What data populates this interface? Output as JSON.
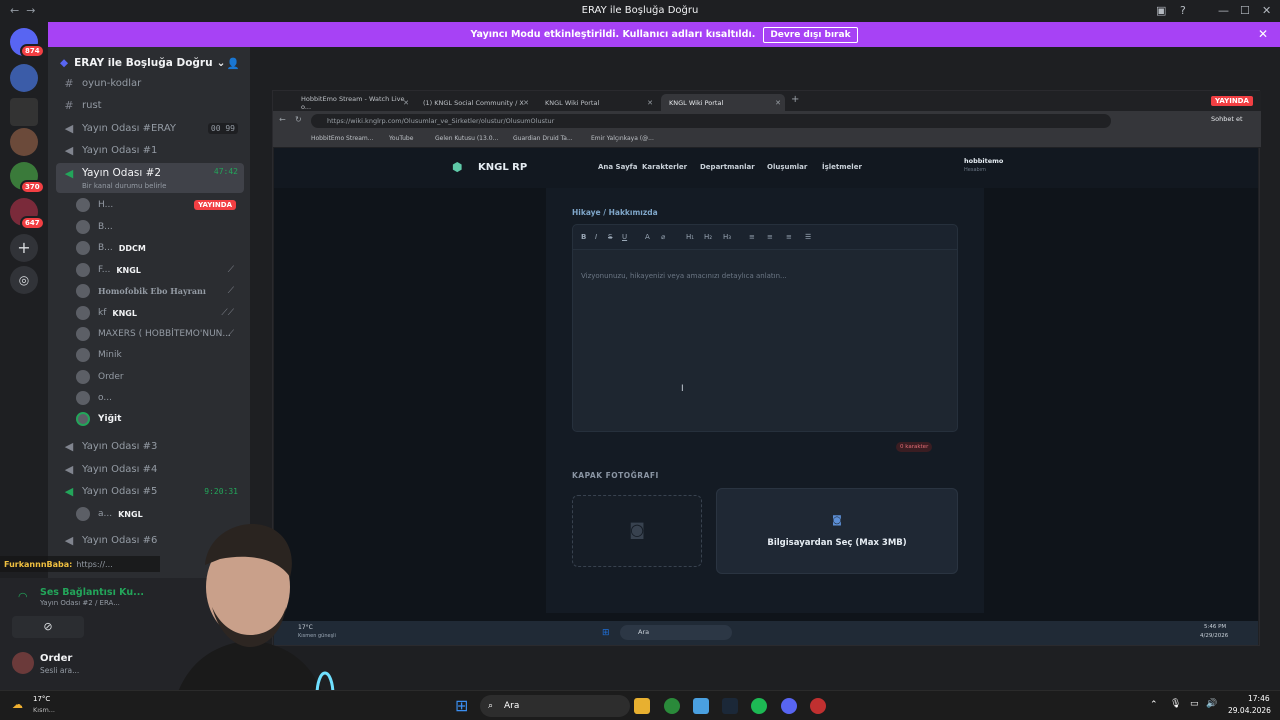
{
  "window": {
    "title": "ERAY ile Boşluğa Doğru"
  },
  "banner": {
    "text": "Yayıncı Modu etkinleştirildi. Kullanıcı adları kısaltıldı.",
    "button": "Devre dışı bırak"
  },
  "rail": {
    "badges": [
      "874",
      "370",
      "647"
    ]
  },
  "server": {
    "name": "ERAY ile Boşluğa Doğru"
  },
  "channels": [
    {
      "name": "oyun-kodlar",
      "type": "text"
    },
    {
      "name": "rust",
      "type": "text"
    },
    {
      "name": "Yayın Odası #ERAY",
      "type": "voice",
      "right": "00 99"
    },
    {
      "name": "Yayın Odası #1",
      "type": "voice"
    },
    {
      "name": "Yayın Odası #2",
      "type": "voice",
      "timer": "47:42",
      "status": "Bir kanal durumu belirle"
    },
    {
      "name": "Yayın Odası #3",
      "type": "voice"
    },
    {
      "name": "Yayın Odası #4",
      "type": "voice"
    },
    {
      "name": "Yayın Odası #5",
      "type": "voice",
      "timer": "9:20:31"
    },
    {
      "name": "Yayın Odası #6",
      "type": "voice"
    }
  ],
  "voice_users": [
    {
      "name": "H...",
      "live": "YAYINDA"
    },
    {
      "name": "B..."
    },
    {
      "name": "B...",
      "tag": "DDCM"
    },
    {
      "name": "F...",
      "tag": "KNGL"
    },
    {
      "name": "Homofobik Ebo Hayranı"
    },
    {
      "name": "kf",
      "tag": "KNGL"
    },
    {
      "name": "MAXERS ( HOBBİTEMO'NUN..."
    },
    {
      "name": "Minik"
    },
    {
      "name": "Order"
    },
    {
      "name": "o..."
    },
    {
      "name": "Yiğit"
    }
  ],
  "room5_user": {
    "name": "a...",
    "tag": "KNGL"
  },
  "ticker": {
    "user": "FurkannnBaba:",
    "text": "https://..."
  },
  "voice_panel": {
    "status": "Ses Bağlantısı Ku...",
    "room": "Yayın Odası #2 / ERA...",
    "user": "Order",
    "sub": "Sesli ara..."
  },
  "browser": {
    "live": "YAYINDA",
    "tabs": [
      "HobbitEmo Stream - Watch Live o...",
      "(1) KNGL Social Community / X",
      "KNGL Wiki Portal",
      "KNGL Wiki Portal"
    ],
    "url": "https://wiki.knglrp.com/Olusumlar_ve_Sirketler/olustur/OlusumOlustur",
    "bookmarks": [
      "HobbitEmo Stream...",
      "YouTube",
      "Gelen Kutusu (13.0...",
      "Guardian Druid Ta...",
      "Emir Yalçınkaya (@..."
    ],
    "chat": "Sohbet et"
  },
  "site": {
    "brand": "KNGL RP",
    "nav": [
      "Ana Sayfa",
      "Karakterler",
      "Departmanlar",
      "Oluşumlar",
      "İşletmeler"
    ],
    "user": "hobbitemo",
    "user_sub": "Hesabım"
  },
  "editor": {
    "label": "Hikaye / Hakkımızda",
    "toolbar": [
      "B",
      "I",
      "S",
      "U",
      "A",
      "⌀",
      "H₁",
      "H₂",
      "H₃",
      "≡",
      "≡",
      "≡",
      "☰"
    ],
    "placeholder": "Vizyonunuzu, hikayenizi veya amacınızı detaylıca anlatın...",
    "char_count": "0 karakter"
  },
  "cover": {
    "label": "KAPAK FOTOĞRAFI",
    "button": "Bilgisayardan Seç (Max 3MB)"
  },
  "inner_taskbar": {
    "weather": "17°C",
    "weather_sub": "Kısmen güneşli",
    "search": "Ara",
    "time": "5:46 PM",
    "date": "4/29/2026"
  },
  "taskbar": {
    "weather": "17°C",
    "weather_sub": "Kısm...",
    "search": "Ara",
    "time": "17:46",
    "date": "29.04.2026"
  },
  "colors": {
    "banner": "#a742f5",
    "live": "#f23f43",
    "voice_active": "#23a55a"
  }
}
